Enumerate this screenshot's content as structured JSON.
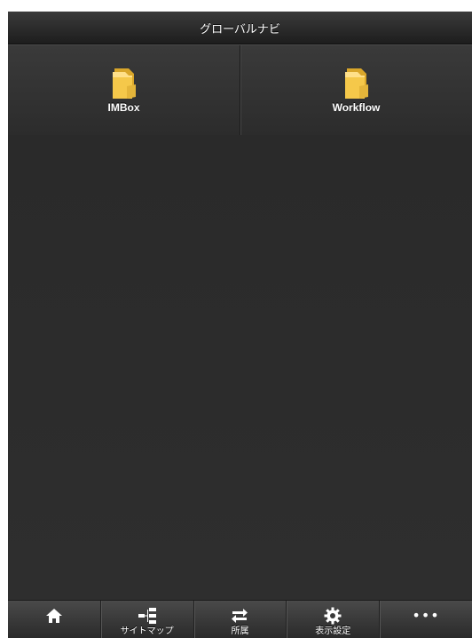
{
  "header": {
    "title": "グローバルナビ"
  },
  "tiles": [
    {
      "label": "IMBox",
      "icon": "folder-icon"
    },
    {
      "label": "Workflow",
      "icon": "folder-icon"
    }
  ],
  "footer": {
    "items": [
      {
        "label": "",
        "icon": "home-icon"
      },
      {
        "label": "サイトマップ",
        "icon": "sitemap-icon"
      },
      {
        "label": "所属",
        "icon": "switch-arrows-icon"
      },
      {
        "label": "表示設定",
        "icon": "gear-icon"
      },
      {
        "label": "",
        "icon": "more-dots-icon",
        "text": "•••"
      }
    ]
  },
  "colors": {
    "folder_fill": "#f5c84a",
    "folder_shade": "#d9a62a",
    "background": "#2b2b2b"
  }
}
